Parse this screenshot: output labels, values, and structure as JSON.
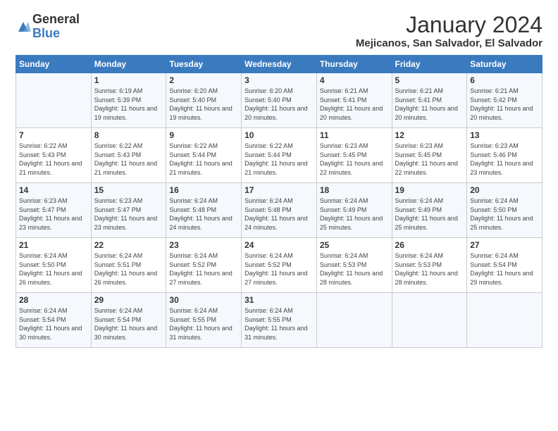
{
  "logo": {
    "general": "General",
    "blue": "Blue"
  },
  "title": "January 2024",
  "location": "Mejicanos, San Salvador, El Salvador",
  "headers": [
    "Sunday",
    "Monday",
    "Tuesday",
    "Wednesday",
    "Thursday",
    "Friday",
    "Saturday"
  ],
  "weeks": [
    [
      {
        "day": "",
        "sunrise": "",
        "sunset": "",
        "daylight": ""
      },
      {
        "day": "1",
        "sunrise": "Sunrise: 6:19 AM",
        "sunset": "Sunset: 5:39 PM",
        "daylight": "Daylight: 11 hours and 19 minutes."
      },
      {
        "day": "2",
        "sunrise": "Sunrise: 6:20 AM",
        "sunset": "Sunset: 5:40 PM",
        "daylight": "Daylight: 11 hours and 19 minutes."
      },
      {
        "day": "3",
        "sunrise": "Sunrise: 6:20 AM",
        "sunset": "Sunset: 5:40 PM",
        "daylight": "Daylight: 11 hours and 20 minutes."
      },
      {
        "day": "4",
        "sunrise": "Sunrise: 6:21 AM",
        "sunset": "Sunset: 5:41 PM",
        "daylight": "Daylight: 11 hours and 20 minutes."
      },
      {
        "day": "5",
        "sunrise": "Sunrise: 6:21 AM",
        "sunset": "Sunset: 5:41 PM",
        "daylight": "Daylight: 11 hours and 20 minutes."
      },
      {
        "day": "6",
        "sunrise": "Sunrise: 6:21 AM",
        "sunset": "Sunset: 5:42 PM",
        "daylight": "Daylight: 11 hours and 20 minutes."
      }
    ],
    [
      {
        "day": "7",
        "sunrise": "Sunrise: 6:22 AM",
        "sunset": "Sunset: 5:43 PM",
        "daylight": "Daylight: 11 hours and 21 minutes."
      },
      {
        "day": "8",
        "sunrise": "Sunrise: 6:22 AM",
        "sunset": "Sunset: 5:43 PM",
        "daylight": "Daylight: 11 hours and 21 minutes."
      },
      {
        "day": "9",
        "sunrise": "Sunrise: 6:22 AM",
        "sunset": "Sunset: 5:44 PM",
        "daylight": "Daylight: 11 hours and 21 minutes."
      },
      {
        "day": "10",
        "sunrise": "Sunrise: 6:22 AM",
        "sunset": "Sunset: 5:44 PM",
        "daylight": "Daylight: 11 hours and 21 minutes."
      },
      {
        "day": "11",
        "sunrise": "Sunrise: 6:23 AM",
        "sunset": "Sunset: 5:45 PM",
        "daylight": "Daylight: 11 hours and 22 minutes."
      },
      {
        "day": "12",
        "sunrise": "Sunrise: 6:23 AM",
        "sunset": "Sunset: 5:45 PM",
        "daylight": "Daylight: 11 hours and 22 minutes."
      },
      {
        "day": "13",
        "sunrise": "Sunrise: 6:23 AM",
        "sunset": "Sunset: 5:46 PM",
        "daylight": "Daylight: 11 hours and 23 minutes."
      }
    ],
    [
      {
        "day": "14",
        "sunrise": "Sunrise: 6:23 AM",
        "sunset": "Sunset: 5:47 PM",
        "daylight": "Daylight: 11 hours and 23 minutes."
      },
      {
        "day": "15",
        "sunrise": "Sunrise: 6:23 AM",
        "sunset": "Sunset: 5:47 PM",
        "daylight": "Daylight: 11 hours and 23 minutes."
      },
      {
        "day": "16",
        "sunrise": "Sunrise: 6:24 AM",
        "sunset": "Sunset: 5:48 PM",
        "daylight": "Daylight: 11 hours and 24 minutes."
      },
      {
        "day": "17",
        "sunrise": "Sunrise: 6:24 AM",
        "sunset": "Sunset: 5:48 PM",
        "daylight": "Daylight: 11 hours and 24 minutes."
      },
      {
        "day": "18",
        "sunrise": "Sunrise: 6:24 AM",
        "sunset": "Sunset: 5:49 PM",
        "daylight": "Daylight: 11 hours and 25 minutes."
      },
      {
        "day": "19",
        "sunrise": "Sunrise: 6:24 AM",
        "sunset": "Sunset: 5:49 PM",
        "daylight": "Daylight: 11 hours and 25 minutes."
      },
      {
        "day": "20",
        "sunrise": "Sunrise: 6:24 AM",
        "sunset": "Sunset: 5:50 PM",
        "daylight": "Daylight: 11 hours and 25 minutes."
      }
    ],
    [
      {
        "day": "21",
        "sunrise": "Sunrise: 6:24 AM",
        "sunset": "Sunset: 5:50 PM",
        "daylight": "Daylight: 11 hours and 26 minutes."
      },
      {
        "day": "22",
        "sunrise": "Sunrise: 6:24 AM",
        "sunset": "Sunset: 5:51 PM",
        "daylight": "Daylight: 11 hours and 26 minutes."
      },
      {
        "day": "23",
        "sunrise": "Sunrise: 6:24 AM",
        "sunset": "Sunset: 5:52 PM",
        "daylight": "Daylight: 11 hours and 27 minutes."
      },
      {
        "day": "24",
        "sunrise": "Sunrise: 6:24 AM",
        "sunset": "Sunset: 5:52 PM",
        "daylight": "Daylight: 11 hours and 27 minutes."
      },
      {
        "day": "25",
        "sunrise": "Sunrise: 6:24 AM",
        "sunset": "Sunset: 5:53 PM",
        "daylight": "Daylight: 11 hours and 28 minutes."
      },
      {
        "day": "26",
        "sunrise": "Sunrise: 6:24 AM",
        "sunset": "Sunset: 5:53 PM",
        "daylight": "Daylight: 11 hours and 28 minutes."
      },
      {
        "day": "27",
        "sunrise": "Sunrise: 6:24 AM",
        "sunset": "Sunset: 5:54 PM",
        "daylight": "Daylight: 11 hours and 29 minutes."
      }
    ],
    [
      {
        "day": "28",
        "sunrise": "Sunrise: 6:24 AM",
        "sunset": "Sunset: 5:54 PM",
        "daylight": "Daylight: 11 hours and 30 minutes."
      },
      {
        "day": "29",
        "sunrise": "Sunrise: 6:24 AM",
        "sunset": "Sunset: 5:54 PM",
        "daylight": "Daylight: 11 hours and 30 minutes."
      },
      {
        "day": "30",
        "sunrise": "Sunrise: 6:24 AM",
        "sunset": "Sunset: 5:55 PM",
        "daylight": "Daylight: 11 hours and 31 minutes."
      },
      {
        "day": "31",
        "sunrise": "Sunrise: 6:24 AM",
        "sunset": "Sunset: 5:55 PM",
        "daylight": "Daylight: 11 hours and 31 minutes."
      },
      {
        "day": "",
        "sunrise": "",
        "sunset": "",
        "daylight": ""
      },
      {
        "day": "",
        "sunrise": "",
        "sunset": "",
        "daylight": ""
      },
      {
        "day": "",
        "sunrise": "",
        "sunset": "",
        "daylight": ""
      }
    ]
  ]
}
